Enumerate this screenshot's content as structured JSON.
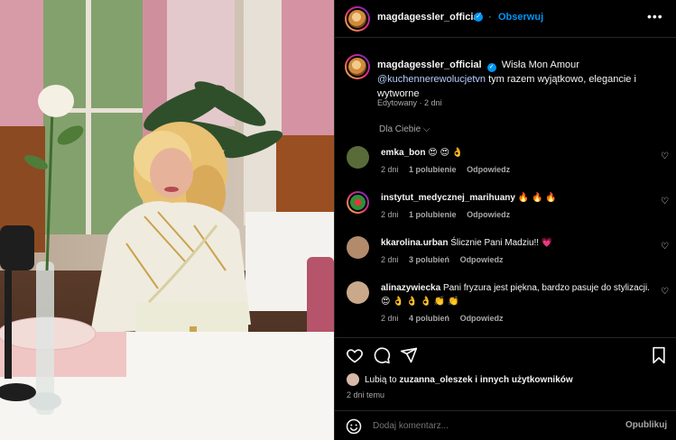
{
  "header": {
    "username": "magdagessler_official",
    "follow_label": "Obserwuj",
    "more_icon": "more-icon"
  },
  "caption": {
    "username": "magdagessler_official",
    "text": "Wisła Mon Amour",
    "mention": "@kuchennerewolucjetvn",
    "text2": " tym razem wyjątkowo, elegancie i wytworne",
    "edited": "Edytowany · 2 dni"
  },
  "comments_filter": "Dla Ciebie",
  "comments": [
    {
      "username": "emka_bon",
      "text": "😍 😍 👌",
      "age": "2 dni",
      "likes": "1 polubienie",
      "reply": "Odpowiedz",
      "avatar_color": "#5a6b3a"
    },
    {
      "username": "instytut_medycznej_marihuany",
      "text": "🔥 🔥 🔥",
      "age": "2 dni",
      "likes": "1 polubienie",
      "reply": "Odpowiedz",
      "avatar_color": "#2f8f3a"
    },
    {
      "username": "kkarolina.urban",
      "text": "Ślicznie Pani Madziu!! 💗",
      "age": "2 dni",
      "likes": "3 polubień",
      "reply": "Odpowiedz",
      "avatar_color": "#b28a6c"
    },
    {
      "username": "alinazywiecka",
      "text": "Pani fryzura jest piękna, bardzo pasuje do stylizacji. 😍 👌 👌 👌 👏 👏",
      "age": "2 dni",
      "likes": "4 polubień",
      "reply": "Odpowiedz",
      "avatar_color": "#c9a98a"
    }
  ],
  "likes_line": {
    "prefix": "Lubią to ",
    "user": "zuzanna_oleszek",
    "suffix": " i innych użytkowników"
  },
  "time_ago": "2 dni temu",
  "input": {
    "placeholder": "Dodaj komentarz...",
    "publish_label": "Opublikuj"
  },
  "colors": {
    "accent": "#0095f6",
    "bg": "#000000",
    "muted": "#a8a8a8"
  }
}
